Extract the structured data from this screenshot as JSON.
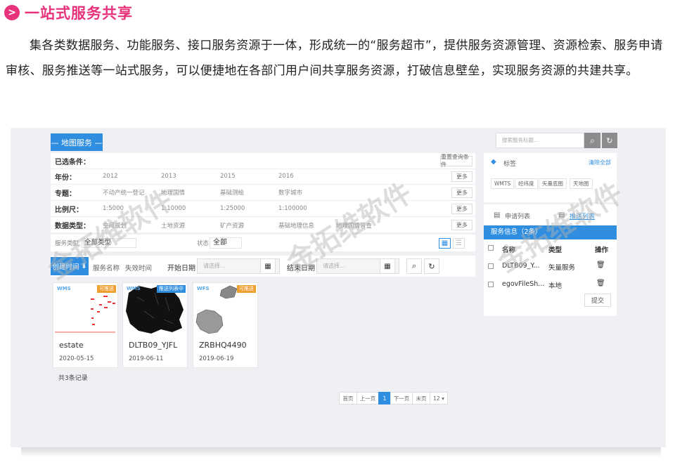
{
  "heading": {
    "bullet": ">",
    "title": "一站式服务共享"
  },
  "intro": "集各类数据服务、功能服务、接口服务资源于一体，形成统一的“服务超市”，提供服务资源管理、资源检索、服务申请审核、服务推送等一站式服务，可以便捷地在各部门用户间共享服务资源，打破信息壁垒，实现服务资源的共建共享。",
  "app": {
    "tab_label": "— 地图服务 —",
    "filter": {
      "selected_label": "已选条件：",
      "reset_label": "重置查询条件",
      "more_label": "更多",
      "rows": [
        {
          "label": "年份：",
          "options": [
            "2012",
            "2013",
            "2015",
            "2016"
          ]
        },
        {
          "label": "专题：",
          "options": [
            "不动产统一登记",
            "地理国情",
            "基础测绘",
            "数字城市"
          ]
        },
        {
          "label": "比例尺：",
          "options": [
            "1:5000",
            "1:10000",
            "1:25000",
            "1:100000"
          ]
        },
        {
          "label": "数据类型：",
          "options": [
            "空间规划",
            "土地资源",
            "矿产资源",
            "基础地理信息",
            "地理国情普查"
          ]
        }
      ]
    },
    "service_bar": {
      "type_label": "服务类型",
      "type_value": "全部类型",
      "state_label": "状态",
      "state_value": "全部"
    },
    "sortbar": {
      "created": "创建时间",
      "name": "服务名称",
      "expire": "失效时间",
      "start_label": "开始日期",
      "end_label": "结束日期",
      "date_placeholder": "请选择..."
    },
    "cards": [
      {
        "type": "WMS",
        "badge": "可推送",
        "badge_color": "#f0a030",
        "name": "estate",
        "date": "2020-05-15"
      },
      {
        "type": "WMS",
        "badge": "推送列表中",
        "badge_color": "#2f8ee0",
        "name": "DLTB09_YJFL",
        "date": "2019-06-11"
      },
      {
        "type": "WFS",
        "badge": "可推送",
        "badge_color": "#f0a030",
        "name": "ZRBHQ4490",
        "date": "2019-06-19"
      }
    ],
    "count_text": "共3条记录",
    "pager": [
      "首页",
      "上一页",
      "1",
      "下一页",
      "末页",
      "12 ▾"
    ],
    "search_placeholder": "搜索服务标题...",
    "tags": {
      "label": "标签",
      "clear": "清除全部",
      "items": [
        "WMTS",
        "经纬度",
        "矢量底图",
        "天地图"
      ]
    },
    "apply": {
      "tab_apply": "申请列表",
      "tab_push": "推送列表",
      "bar": "服务信息（2条）",
      "headers": [
        "名称",
        "类型",
        "操作"
      ],
      "rows": [
        {
          "name": "DLTB09_Y...",
          "type": "矢量服务"
        },
        {
          "name": "egovFileSh...",
          "type": "本地"
        }
      ],
      "submit": "提交"
    },
    "watermark": "金拓维软件"
  },
  "colors": {
    "accent": "#e8327c",
    "primary": "#2f8ee0",
    "badge_orange": "#f0a030"
  }
}
